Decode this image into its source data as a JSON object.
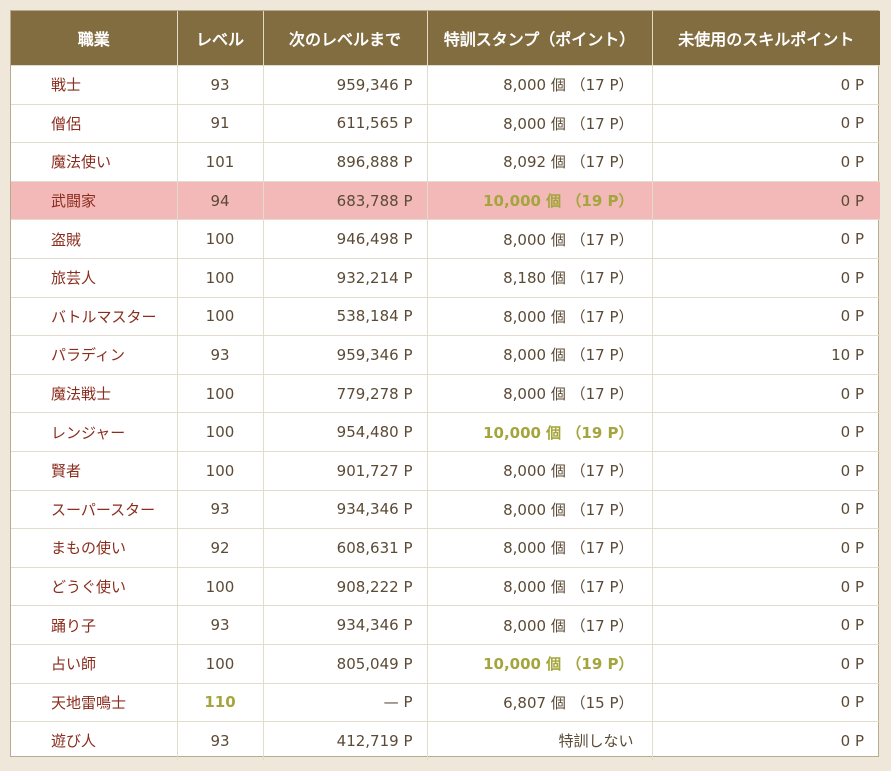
{
  "columns": [
    "職業",
    "レベル",
    "次のレベルまで",
    "特訓スタンプ（ポイント）",
    "未使用のスキルポイント"
  ],
  "rows": [
    {
      "job": "戦士",
      "level": "93",
      "next": "959,346 P",
      "stamp": "8,000 個 （17 P）",
      "skill": "0 P",
      "highlight": false,
      "level_gold": false,
      "stamp_gold": false
    },
    {
      "job": "僧侶",
      "level": "91",
      "next": "611,565 P",
      "stamp": "8,000 個 （17 P）",
      "skill": "0 P",
      "highlight": false,
      "level_gold": false,
      "stamp_gold": false
    },
    {
      "job": "魔法使い",
      "level": "101",
      "next": "896,888 P",
      "stamp": "8,092 個 （17 P）",
      "skill": "0 P",
      "highlight": false,
      "level_gold": false,
      "stamp_gold": false
    },
    {
      "job": "武闘家",
      "level": "94",
      "next": "683,788 P",
      "stamp": "10,000 個 （19 P）",
      "skill": "0 P",
      "highlight": true,
      "level_gold": false,
      "stamp_gold": true
    },
    {
      "job": "盗賊",
      "level": "100",
      "next": "946,498 P",
      "stamp": "8,000 個 （17 P）",
      "skill": "0 P",
      "highlight": false,
      "level_gold": false,
      "stamp_gold": false
    },
    {
      "job": "旅芸人",
      "level": "100",
      "next": "932,214 P",
      "stamp": "8,180 個 （17 P）",
      "skill": "0 P",
      "highlight": false,
      "level_gold": false,
      "stamp_gold": false
    },
    {
      "job": "バトルマスター",
      "level": "100",
      "next": "538,184 P",
      "stamp": "8,000 個 （17 P）",
      "skill": "0 P",
      "highlight": false,
      "level_gold": false,
      "stamp_gold": false
    },
    {
      "job": "パラディン",
      "level": "93",
      "next": "959,346 P",
      "stamp": "8,000 個 （17 P）",
      "skill": "10 P",
      "highlight": false,
      "level_gold": false,
      "stamp_gold": false
    },
    {
      "job": "魔法戦士",
      "level": "100",
      "next": "779,278 P",
      "stamp": "8,000 個 （17 P）",
      "skill": "0 P",
      "highlight": false,
      "level_gold": false,
      "stamp_gold": false
    },
    {
      "job": "レンジャー",
      "level": "100",
      "next": "954,480 P",
      "stamp": "10,000 個 （19 P）",
      "skill": "0 P",
      "highlight": false,
      "level_gold": false,
      "stamp_gold": true
    },
    {
      "job": "賢者",
      "level": "100",
      "next": "901,727 P",
      "stamp": "8,000 個 （17 P）",
      "skill": "0 P",
      "highlight": false,
      "level_gold": false,
      "stamp_gold": false
    },
    {
      "job": "スーパースター",
      "level": "93",
      "next": "934,346 P",
      "stamp": "8,000 個 （17 P）",
      "skill": "0 P",
      "highlight": false,
      "level_gold": false,
      "stamp_gold": false
    },
    {
      "job": "まもの使い",
      "level": "92",
      "next": "608,631 P",
      "stamp": "8,000 個 （17 P）",
      "skill": "0 P",
      "highlight": false,
      "level_gold": false,
      "stamp_gold": false
    },
    {
      "job": "どうぐ使い",
      "level": "100",
      "next": "908,222 P",
      "stamp": "8,000 個 （17 P）",
      "skill": "0 P",
      "highlight": false,
      "level_gold": false,
      "stamp_gold": false
    },
    {
      "job": "踊り子",
      "level": "93",
      "next": "934,346 P",
      "stamp": "8,000 個 （17 P）",
      "skill": "0 P",
      "highlight": false,
      "level_gold": false,
      "stamp_gold": false
    },
    {
      "job": "占い師",
      "level": "100",
      "next": "805,049 P",
      "stamp": "10,000 個 （19 P）",
      "skill": "0 P",
      "highlight": false,
      "level_gold": false,
      "stamp_gold": true
    },
    {
      "job": "天地雷鳴士",
      "level": "110",
      "next": "— P",
      "stamp": "6,807 個 （15 P）",
      "skill": "0 P",
      "highlight": false,
      "level_gold": true,
      "stamp_gold": false
    },
    {
      "job": "遊び人",
      "level": "93",
      "next": "412,719 P",
      "stamp": "特訓しない",
      "skill": "0 P",
      "highlight": false,
      "level_gold": false,
      "stamp_gold": false
    }
  ],
  "colors": {
    "header_bg": "#826d41",
    "header_text": "#ffffff",
    "job_text": "#8b2d1e",
    "highlight_row": "#f2b9b8",
    "gold_text": "#a4a53c"
  }
}
